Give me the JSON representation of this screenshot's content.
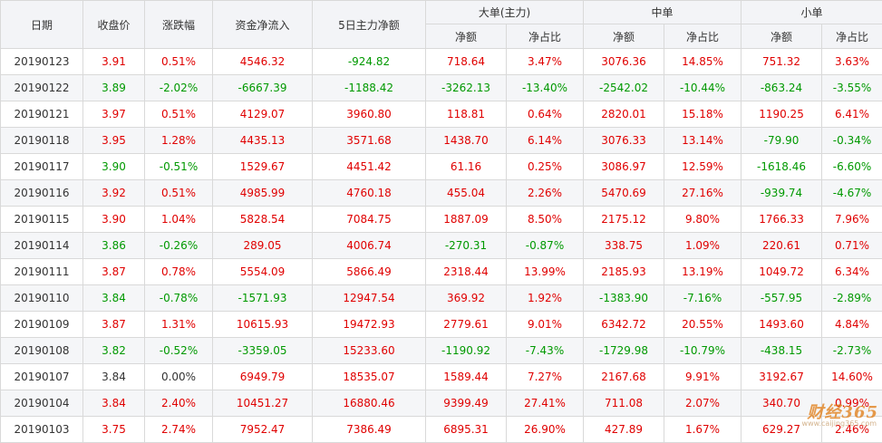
{
  "headers": {
    "date": "日期",
    "close": "收盘价",
    "change": "涨跌幅",
    "net_inflow": "资金净流入",
    "main_5d": "5日主力净额",
    "large_group": "大单(主力)",
    "medium_group": "中单",
    "small_group": "小单",
    "amount": "净额",
    "ratio": "净占比"
  },
  "rows": [
    {
      "date": "20190123",
      "close": "3.91",
      "change": "0.51%",
      "inflow": "4546.32",
      "main5": "-924.82",
      "lg_amt": "718.64",
      "lg_pct": "3.47%",
      "md_amt": "3076.36",
      "md_pct": "14.85%",
      "sm_amt": "751.32",
      "sm_pct": "3.63%"
    },
    {
      "date": "20190122",
      "close": "3.89",
      "change": "-2.02%",
      "inflow": "-6667.39",
      "main5": "-1188.42",
      "lg_amt": "-3262.13",
      "lg_pct": "-13.40%",
      "md_amt": "-2542.02",
      "md_pct": "-10.44%",
      "sm_amt": "-863.24",
      "sm_pct": "-3.55%"
    },
    {
      "date": "20190121",
      "close": "3.97",
      "change": "0.51%",
      "inflow": "4129.07",
      "main5": "3960.80",
      "lg_amt": "118.81",
      "lg_pct": "0.64%",
      "md_amt": "2820.01",
      "md_pct": "15.18%",
      "sm_amt": "1190.25",
      "sm_pct": "6.41%"
    },
    {
      "date": "20190118",
      "close": "3.95",
      "change": "1.28%",
      "inflow": "4435.13",
      "main5": "3571.68",
      "lg_amt": "1438.70",
      "lg_pct": "6.14%",
      "md_amt": "3076.33",
      "md_pct": "13.14%",
      "sm_amt": "-79.90",
      "sm_pct": "-0.34%"
    },
    {
      "date": "20190117",
      "close": "3.90",
      "change": "-0.51%",
      "inflow": "1529.67",
      "main5": "4451.42",
      "lg_amt": "61.16",
      "lg_pct": "0.25%",
      "md_amt": "3086.97",
      "md_pct": "12.59%",
      "sm_amt": "-1618.46",
      "sm_pct": "-6.60%"
    },
    {
      "date": "20190116",
      "close": "3.92",
      "change": "0.51%",
      "inflow": "4985.99",
      "main5": "4760.18",
      "lg_amt": "455.04",
      "lg_pct": "2.26%",
      "md_amt": "5470.69",
      "md_pct": "27.16%",
      "sm_amt": "-939.74",
      "sm_pct": "-4.67%"
    },
    {
      "date": "20190115",
      "close": "3.90",
      "change": "1.04%",
      "inflow": "5828.54",
      "main5": "7084.75",
      "lg_amt": "1887.09",
      "lg_pct": "8.50%",
      "md_amt": "2175.12",
      "md_pct": "9.80%",
      "sm_amt": "1766.33",
      "sm_pct": "7.96%"
    },
    {
      "date": "20190114",
      "close": "3.86",
      "change": "-0.26%",
      "inflow": "289.05",
      "main5": "4006.74",
      "lg_amt": "-270.31",
      "lg_pct": "-0.87%",
      "md_amt": "338.75",
      "md_pct": "1.09%",
      "sm_amt": "220.61",
      "sm_pct": "0.71%"
    },
    {
      "date": "20190111",
      "close": "3.87",
      "change": "0.78%",
      "inflow": "5554.09",
      "main5": "5866.49",
      "lg_amt": "2318.44",
      "lg_pct": "13.99%",
      "md_amt": "2185.93",
      "md_pct": "13.19%",
      "sm_amt": "1049.72",
      "sm_pct": "6.34%"
    },
    {
      "date": "20190110",
      "close": "3.84",
      "change": "-0.78%",
      "inflow": "-1571.93",
      "main5": "12947.54",
      "lg_amt": "369.92",
      "lg_pct": "1.92%",
      "md_amt": "-1383.90",
      "md_pct": "-7.16%",
      "sm_amt": "-557.95",
      "sm_pct": "-2.89%"
    },
    {
      "date": "20190109",
      "close": "3.87",
      "change": "1.31%",
      "inflow": "10615.93",
      "main5": "19472.93",
      "lg_amt": "2779.61",
      "lg_pct": "9.01%",
      "md_amt": "6342.72",
      "md_pct": "20.55%",
      "sm_amt": "1493.60",
      "sm_pct": "4.84%"
    },
    {
      "date": "20190108",
      "close": "3.82",
      "change": "-0.52%",
      "inflow": "-3359.05",
      "main5": "15233.60",
      "lg_amt": "-1190.92",
      "lg_pct": "-7.43%",
      "md_amt": "-1729.98",
      "md_pct": "-10.79%",
      "sm_amt": "-438.15",
      "sm_pct": "-2.73%"
    },
    {
      "date": "20190107",
      "close": "3.84",
      "change": "0.00%",
      "inflow": "6949.79",
      "main5": "18535.07",
      "lg_amt": "1589.44",
      "lg_pct": "7.27%",
      "md_amt": "2167.68",
      "md_pct": "9.91%",
      "sm_amt": "3192.67",
      "sm_pct": "14.60%"
    },
    {
      "date": "20190104",
      "close": "3.84",
      "change": "2.40%",
      "inflow": "10451.27",
      "main5": "16880.46",
      "lg_amt": "9399.49",
      "lg_pct": "27.41%",
      "md_amt": "711.08",
      "md_pct": "2.07%",
      "sm_amt": "340.70",
      "sm_pct": "0.99%"
    },
    {
      "date": "20190103",
      "close": "3.75",
      "change": "2.74%",
      "inflow": "7952.47",
      "main5": "7386.49",
      "lg_amt": "6895.31",
      "lg_pct": "26.90%",
      "md_amt": "427.89",
      "md_pct": "1.67%",
      "sm_amt": "629.27",
      "sm_pct": "2.46%"
    }
  ],
  "colors": {
    "up": "#e00000",
    "down": "#009900",
    "flat": "#333333"
  },
  "watermark": {
    "brand": "财经365",
    "site": "www.caijing365.com"
  }
}
